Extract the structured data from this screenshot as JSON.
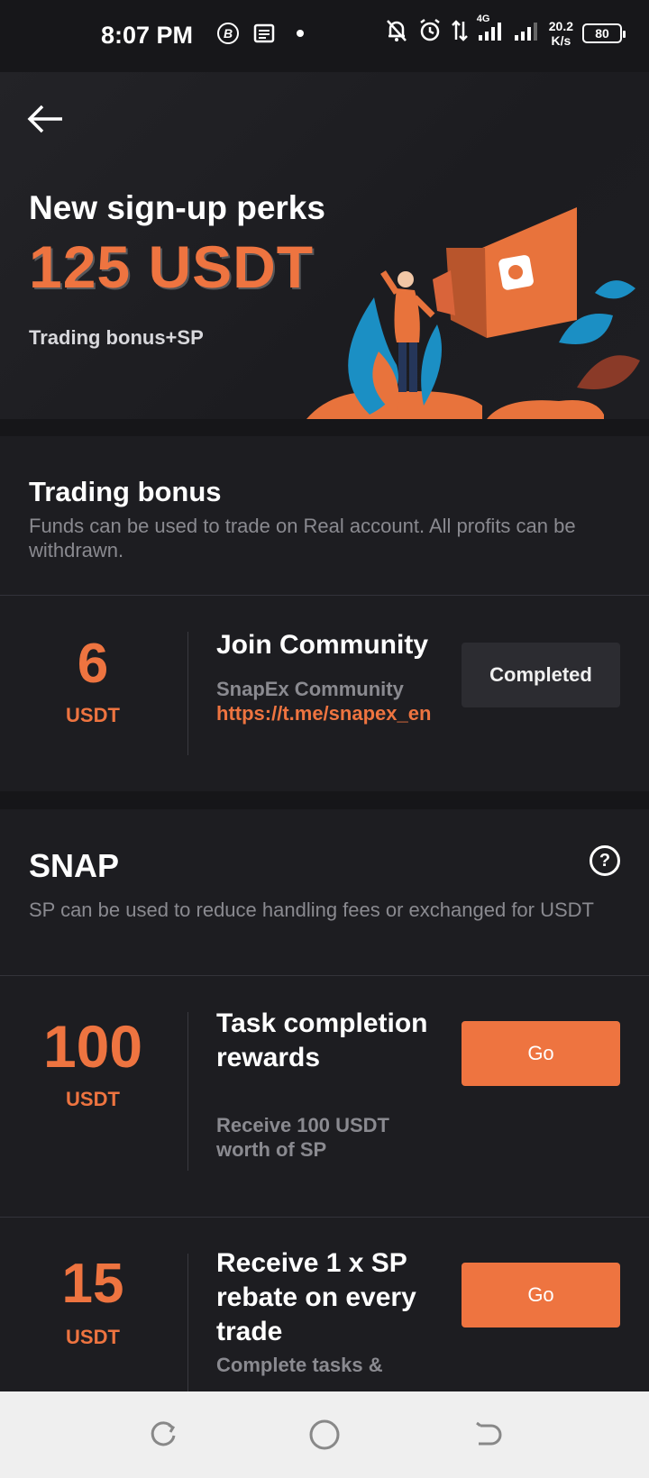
{
  "status_bar": {
    "time": "8:07 PM",
    "network": "4G",
    "speed_value": "20.2",
    "speed_unit": "K/s",
    "battery": "80",
    "icons": [
      "b-circle-icon",
      "news-icon",
      "dot-icon",
      "bell-off-icon",
      "alarm-icon",
      "data-arrows-icon",
      "signal-icon",
      "signal-icon-2"
    ]
  },
  "header": {
    "back_icon": "arrow-left-icon",
    "title": "New sign-up perks",
    "amount": "125 USDT",
    "subtitle": "Trading bonus+SP"
  },
  "trading_bonus": {
    "title": "Trading bonus",
    "description": "Funds can be used to trade on Real account. All profits can be withdrawn.",
    "tasks": [
      {
        "amount": "6",
        "unit": "USDT",
        "title": "Join Community",
        "desc": "SnapEx Community",
        "link": "https://t.me/snapex_en",
        "button": "Completed"
      }
    ]
  },
  "snap": {
    "title": "SNAP",
    "help_icon": "question-circle-icon",
    "help_text": "?",
    "description": "SP can be used to reduce handling fees or exchanged for USDT",
    "tasks": [
      {
        "amount": "100",
        "unit": "USDT",
        "title": "Task completion rewards",
        "desc": "Receive 100 USDT worth of SP",
        "button": "Go"
      },
      {
        "amount": "15",
        "unit": "USDT",
        "title": "Receive 1 x SP rebate on every trade",
        "desc": "Complete tasks &",
        "button": "Go"
      }
    ]
  },
  "nav_bar": {
    "icons": [
      "recent-apps-icon",
      "home-icon",
      "back-icon"
    ]
  },
  "colors": {
    "accent": "#ee7440",
    "background": "#161619",
    "card": "#1d1d21",
    "muted_text": "#8a8a90",
    "nav_bar": "#efefef"
  }
}
